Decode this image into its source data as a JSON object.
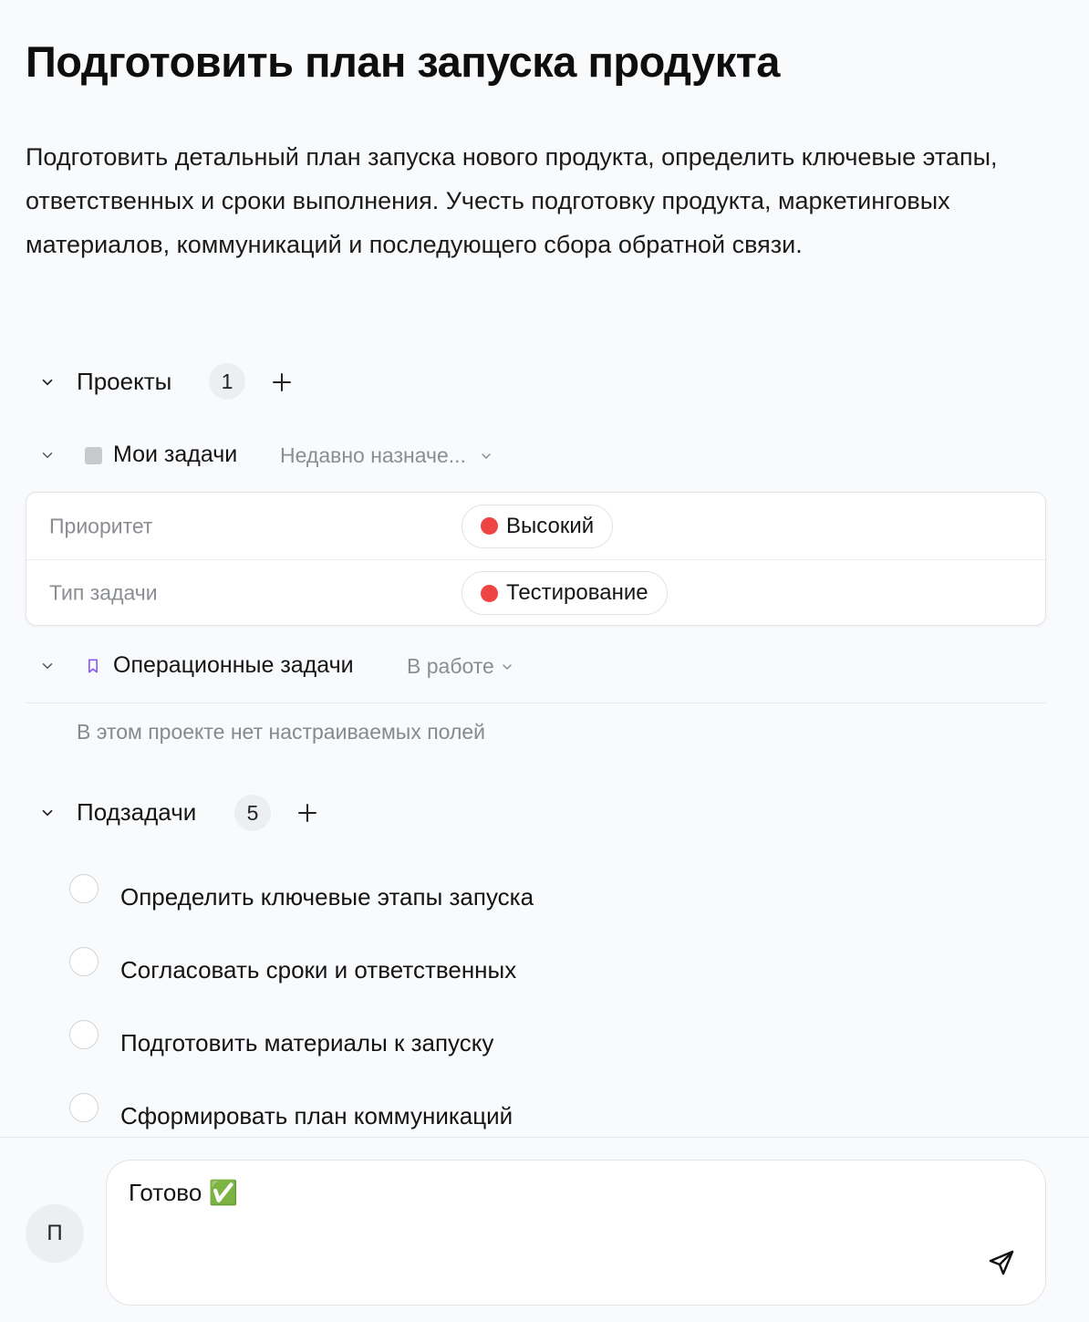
{
  "task": {
    "title": "Подготовить план запуска продукта",
    "description": "Подготовить детальный план запуска нового продукта, определить ключевые этапы, ответственных и сроки выполнения. Учесть подготовку продукта, маркетинговых материалов, коммуникаций и последующего сбора обратной связи."
  },
  "projects": {
    "label": "Проекты",
    "count": "1",
    "items": [
      {
        "name": "Мои задачи",
        "status": "Недавно назначе...",
        "fields": [
          {
            "label": "Приоритет",
            "value": "Высокий",
            "color": "#ef4444"
          },
          {
            "label": "Тип задачи",
            "value": "Тестирование",
            "color": "#ef4444"
          }
        ]
      },
      {
        "name": "Операционные задачи",
        "status": "В работе",
        "empty_note": "В этом проекте нет настраиваемых полей"
      }
    ]
  },
  "subtasks": {
    "label": "Подзадачи",
    "count": "5",
    "items": [
      {
        "title": "Определить ключевые этапы запуска"
      },
      {
        "title": "Согласовать сроки и ответственных"
      },
      {
        "title": "Подготовить материалы к запуску"
      },
      {
        "title": "Сформировать план коммуникаций"
      }
    ]
  },
  "comment": {
    "avatar_initial": "П",
    "text": "Готово ✅"
  },
  "colors": {
    "accent_purple": "#8b5cf6",
    "priority_red": "#ef4444",
    "project_gray": "#c7c9cd"
  },
  "icons": [
    "chevron-down-icon",
    "plus-icon",
    "bookmark-icon",
    "send-icon"
  ]
}
